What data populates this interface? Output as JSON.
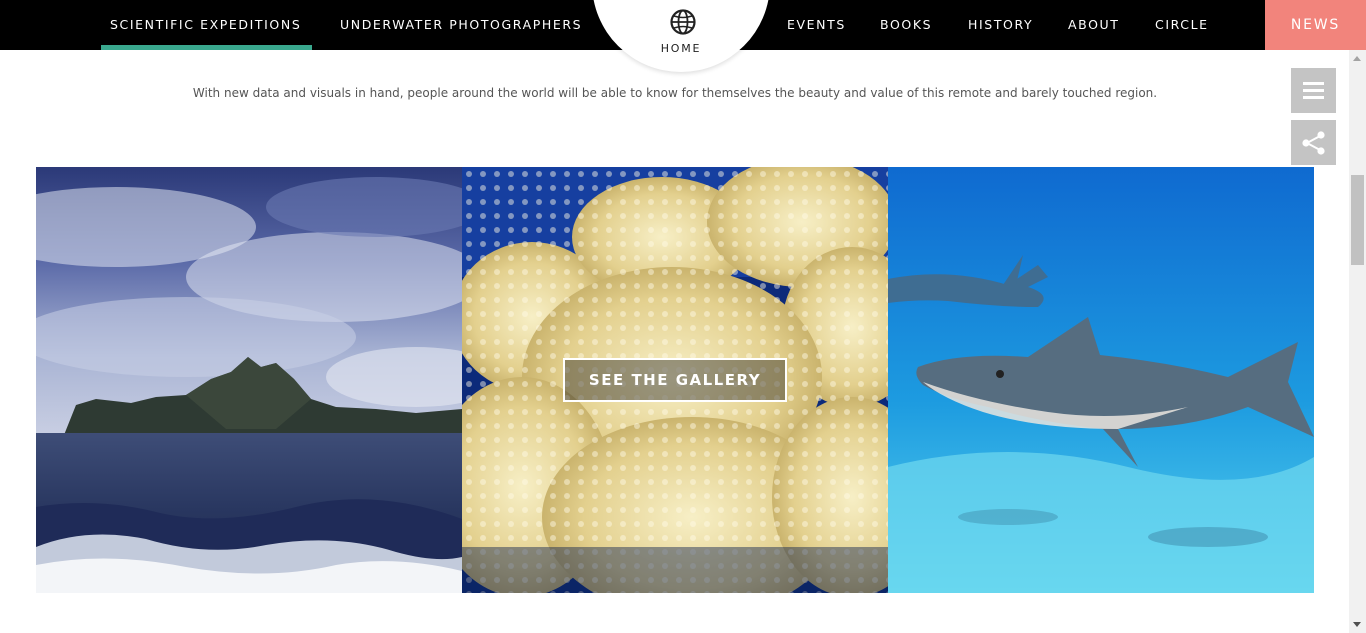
{
  "nav": {
    "items": [
      {
        "label": "SCIENTIFIC EXPEDITIONS",
        "active": true
      },
      {
        "label": "UNDERWATER PHOTOGRAPHERS"
      },
      {
        "label": "EVENTS"
      },
      {
        "label": "BOOKS"
      },
      {
        "label": "HISTORY"
      },
      {
        "label": "ABOUT"
      },
      {
        "label": "CIRCLE"
      }
    ],
    "home_label": "HOME",
    "home_icon": "globe-icon",
    "news_label": "NEWS"
  },
  "tagline": "With new data and visuals in hand, people around the world will be able to know for themselves the beauty and value of this remote and barely touched region.",
  "side_buttons": {
    "menu_icon": "hamburger-icon",
    "share_icon": "share-icon"
  },
  "gallery": {
    "button_label": "SEE THE GALLERY"
  },
  "colors": {
    "accent": "#3aa88e",
    "news": "#f2847c",
    "nav_bg": "#000000",
    "side_button": "#c4c4c4"
  }
}
